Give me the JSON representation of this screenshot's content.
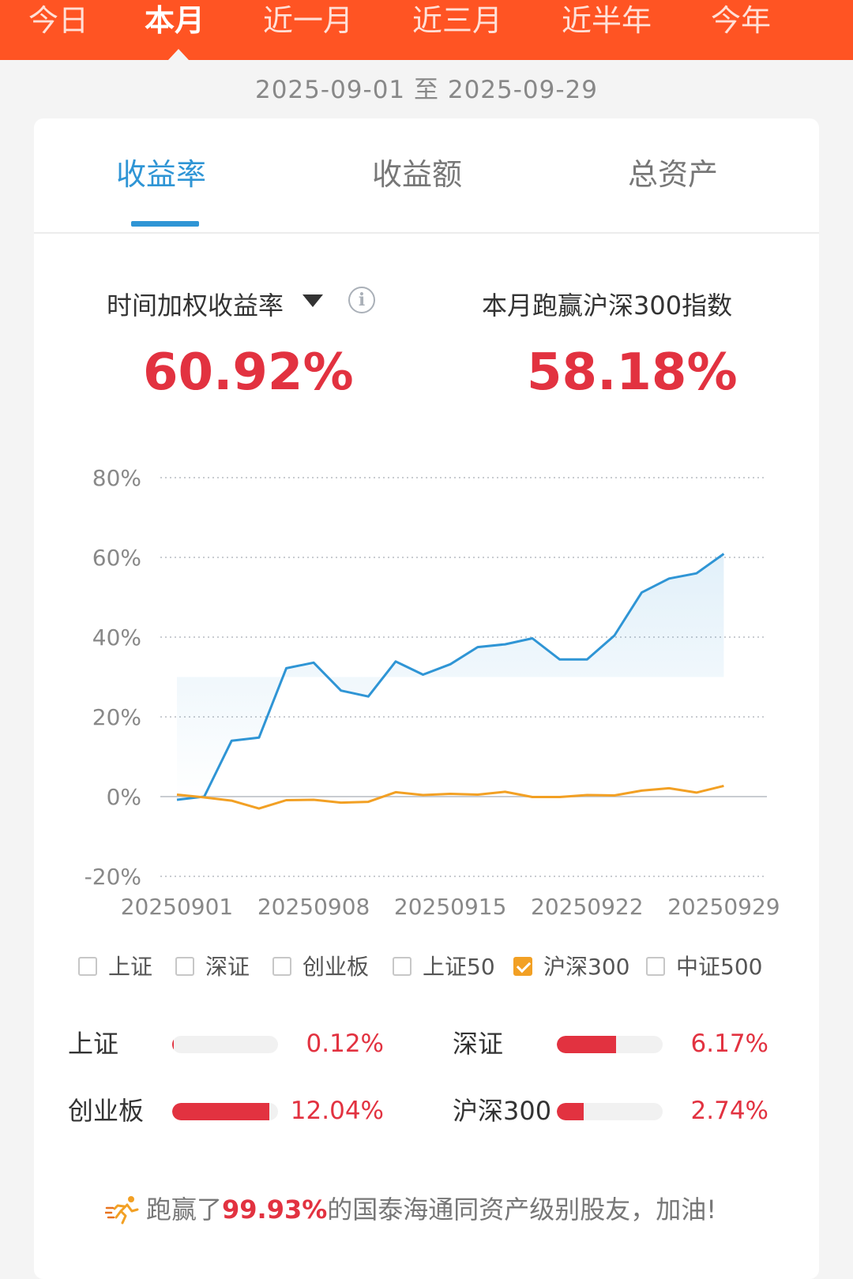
{
  "period_tabs": [
    {
      "label": "今日",
      "active": false
    },
    {
      "label": "本月",
      "active": true
    },
    {
      "label": "近一月",
      "active": false
    },
    {
      "label": "近三月",
      "active": false
    },
    {
      "label": "近半年",
      "active": false
    },
    {
      "label": "今年",
      "active": false
    }
  ],
  "date_range": "2025-09-01 至 2025-09-29",
  "metric_tabs": [
    {
      "label": "收益率",
      "active": true
    },
    {
      "label": "收益额",
      "active": false
    },
    {
      "label": "总资产",
      "active": false
    }
  ],
  "summary": {
    "left_label": "时间加权收益率",
    "left_value": "60.92%",
    "right_label": "本月跑赢沪深300指数",
    "right_value": "58.18%"
  },
  "colors": {
    "header": "#ff5423",
    "accent_blue": "#2f95d5",
    "orange": "#f2a024",
    "red": "#e23240"
  },
  "chart_data": {
    "type": "line",
    "x_tick_labels": [
      "20250901",
      "20250908",
      "20250915",
      "20250922",
      "20250929"
    ],
    "y_tick_labels": [
      "80%",
      "60%",
      "40%",
      "20%",
      "0%",
      "-20%"
    ],
    "ylim": [
      -20,
      80
    ],
    "y_ticks": [
      80,
      60,
      40,
      20,
      0,
      -20
    ],
    "grid": true,
    "series": [
      {
        "color": "#2f95d5",
        "area": true,
        "values": [
          -0.8,
          0.0,
          14.0,
          14.8,
          32.2,
          33.6,
          26.6,
          25.1,
          33.9,
          30.6,
          33.2,
          37.5,
          38.2,
          39.7,
          34.4,
          34.4,
          40.4,
          51.2,
          54.7,
          56.0,
          60.9
        ]
      },
      {
        "color": "#f2a024",
        "area": false,
        "values": [
          0.5,
          -0.2,
          -1.0,
          -3.0,
          -0.9,
          -0.8,
          -1.5,
          -1.3,
          1.1,
          0.4,
          0.7,
          0.5,
          1.2,
          -0.1,
          -0.1,
          0.4,
          0.3,
          1.5,
          2.1,
          1.0,
          2.7
        ]
      }
    ]
  },
  "legend": [
    {
      "label": "上证",
      "checked": false
    },
    {
      "label": "深证",
      "checked": false
    },
    {
      "label": "创业板",
      "checked": false
    },
    {
      "label": "上证50",
      "checked": false
    },
    {
      "label": "沪深300",
      "checked": true
    },
    {
      "label": "中证500",
      "checked": false
    }
  ],
  "indices": [
    {
      "name": "上证",
      "value": "0.12%",
      "ratio": 0.01
    },
    {
      "name": "深证",
      "value": "6.17%",
      "ratio": 0.56
    },
    {
      "name": "创业板",
      "value": "12.04%",
      "ratio": 0.92
    },
    {
      "name": "沪深300",
      "value": "2.74%",
      "ratio": 0.25
    }
  ],
  "footer": {
    "icon": "runner-icon",
    "prefix": "跑赢了",
    "percent": "99.93%",
    "suffix": "的国泰海通同资产级别股友，加油!"
  }
}
